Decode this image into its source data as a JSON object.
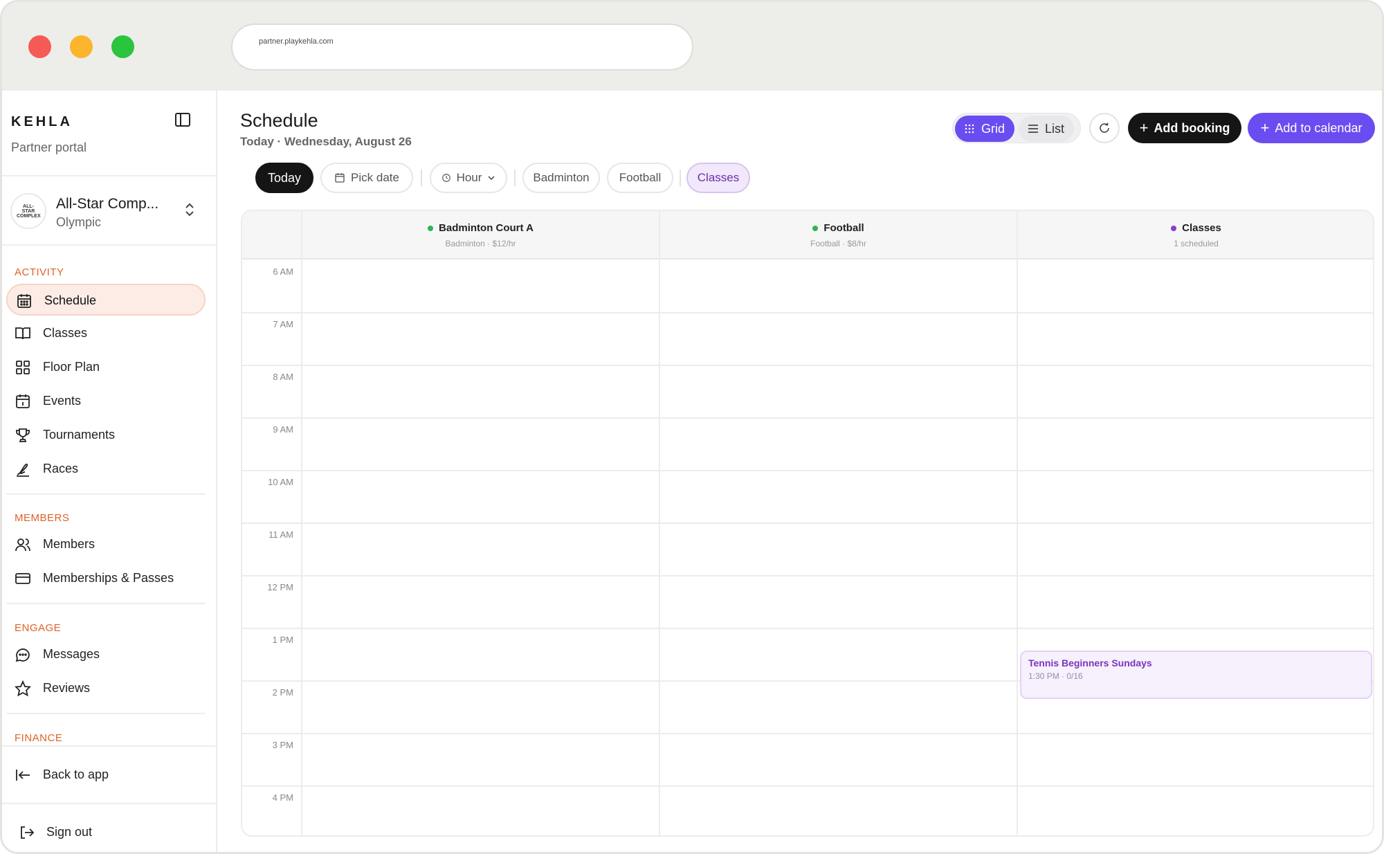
{
  "browser": {
    "url": "partner.playkehla.com"
  },
  "sidebar": {
    "brand": "KEHLA",
    "brand_sub": "Partner portal",
    "org": {
      "name": "All-Star Comp...",
      "sub": "Olympic",
      "avatar_text": "ALL-STAR COMPLEX"
    },
    "sections": {
      "activity": "ACTIVITY",
      "members": "MEMBERS",
      "engage": "ENGAGE",
      "finance": "FINANCE"
    },
    "items": {
      "schedule": "Schedule",
      "classes": "Classes",
      "floor_plan": "Floor Plan",
      "events": "Events",
      "tournaments": "Tournaments",
      "races": "Races",
      "members": "Members",
      "memberships": "Memberships & Passes",
      "messages": "Messages",
      "reviews": "Reviews",
      "back": "Back to app",
      "signout": "Sign out"
    }
  },
  "header": {
    "title": "Schedule",
    "subtitle": "Today · Wednesday, August 26",
    "view_grid": "Grid",
    "view_list": "List",
    "add_booking": "Add booking",
    "add_calendar": "Add to calendar"
  },
  "filters": {
    "today": "Today",
    "pick_date": "Pick date",
    "hour": "Hour",
    "badminton": "Badminton",
    "football": "Football",
    "classes": "Classes"
  },
  "columns": [
    {
      "title": "Badminton Court A",
      "sub": "Badminton · $12/hr",
      "dot": "#2fb552"
    },
    {
      "title": "Football",
      "sub": "Football · $8/hr",
      "dot": "#2fb552"
    },
    {
      "title": "Classes",
      "sub": "1 scheduled",
      "dot": "#8a3fc7"
    }
  ],
  "times": [
    "6 AM",
    "7 AM",
    "8 AM",
    "9 AM",
    "10 AM",
    "11 AM",
    "12 PM",
    "1 PM",
    "2 PM",
    "3 PM",
    "4 PM"
  ],
  "events": [
    {
      "title": "Tennis Beginners Sundays",
      "sub": "1:30 PM · 0/16"
    }
  ],
  "colors": {
    "accent": "#6b4cf0",
    "active_nav": "#fdece5",
    "section_label": "#e0612a"
  }
}
